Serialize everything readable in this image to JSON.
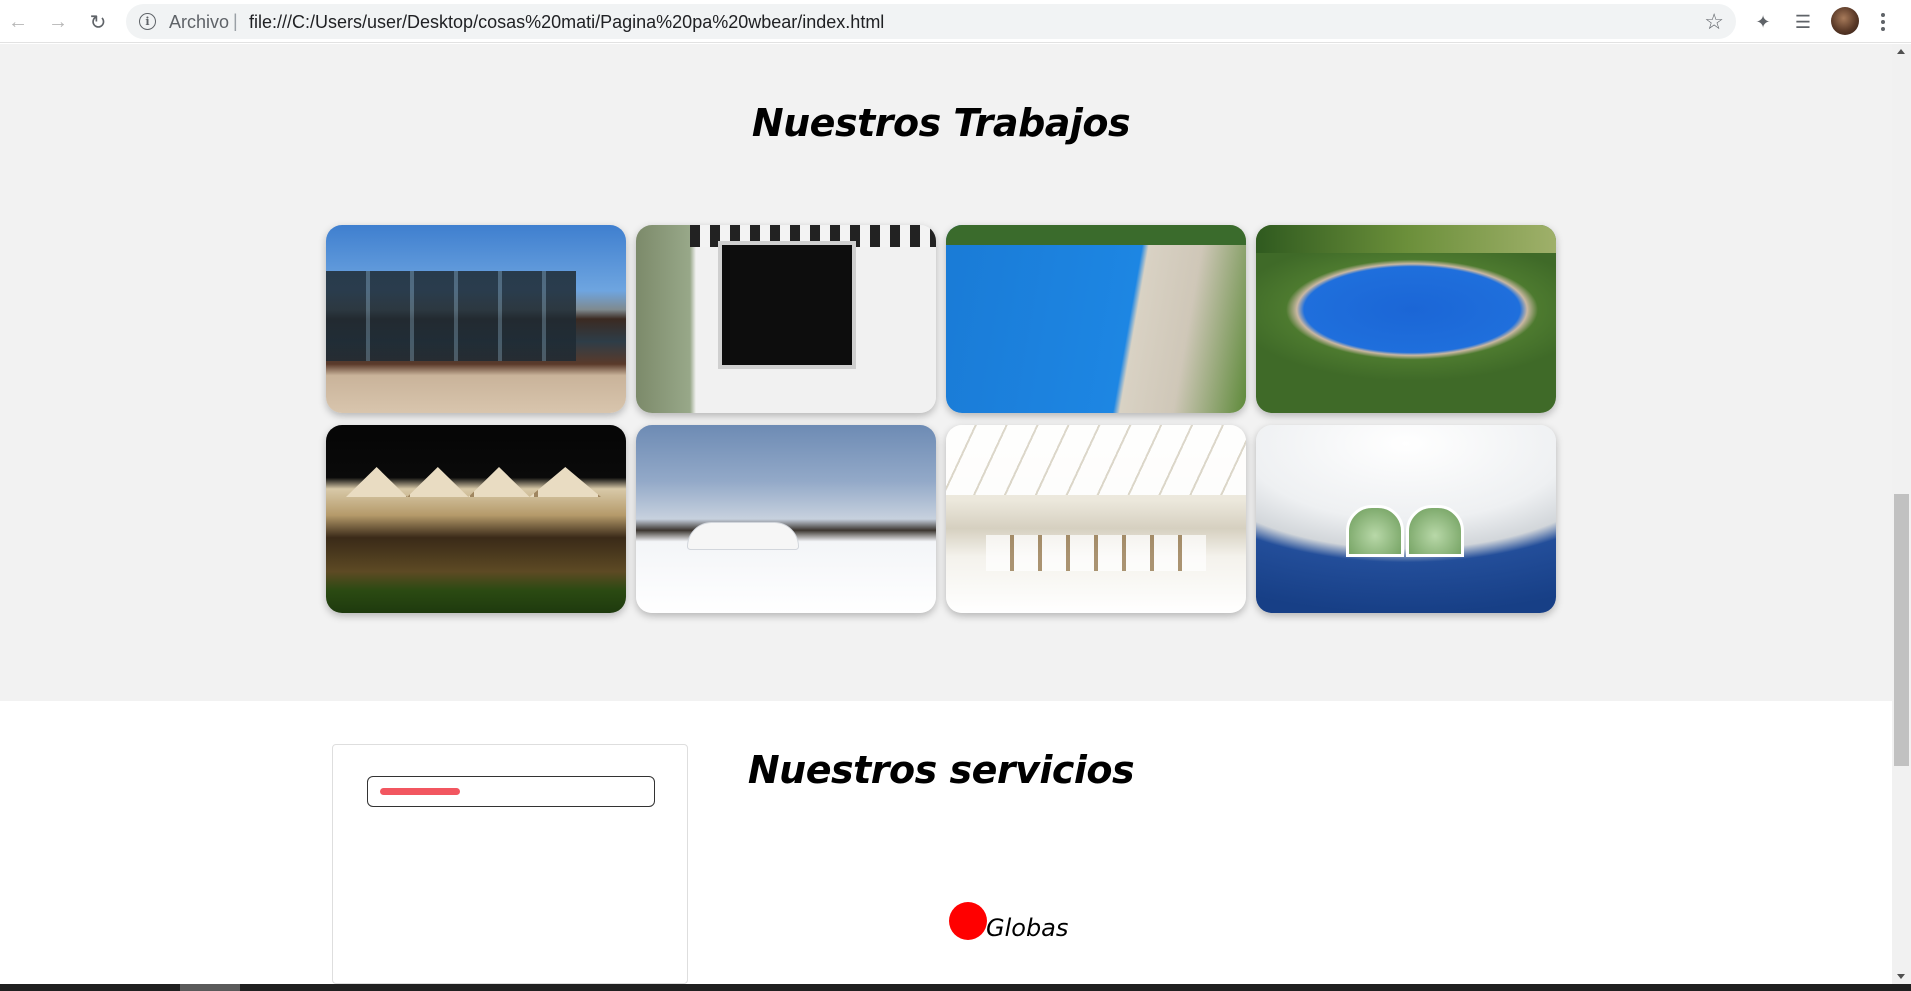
{
  "browser": {
    "scheme_label": "Archivo",
    "separator": "|",
    "url": "file:///C:/Users/user/Desktop/cosas%20mati/Pagina%20pa%20wbear/index.html",
    "icons": [
      "back-icon",
      "forward-icon",
      "reload-icon",
      "info-icon",
      "star-icon",
      "extensions-icon",
      "reading-list-icon",
      "avatar",
      "menu-icon"
    ]
  },
  "trabajos": {
    "title": "Nuestros Trabajos",
    "photos": [
      "photo-glass-pavilion",
      "photo-awning-window",
      "photo-pool-cover",
      "photo-pool-lawn",
      "photo-night-tents",
      "photo-snow-domes",
      "photo-wedding-tent",
      "photo-covered-pool"
    ]
  },
  "servicios": {
    "title": "Nuestros servicios",
    "globe_label": "Globas",
    "accent_color": "#ff0000",
    "field_bar_color": "#f25660"
  }
}
